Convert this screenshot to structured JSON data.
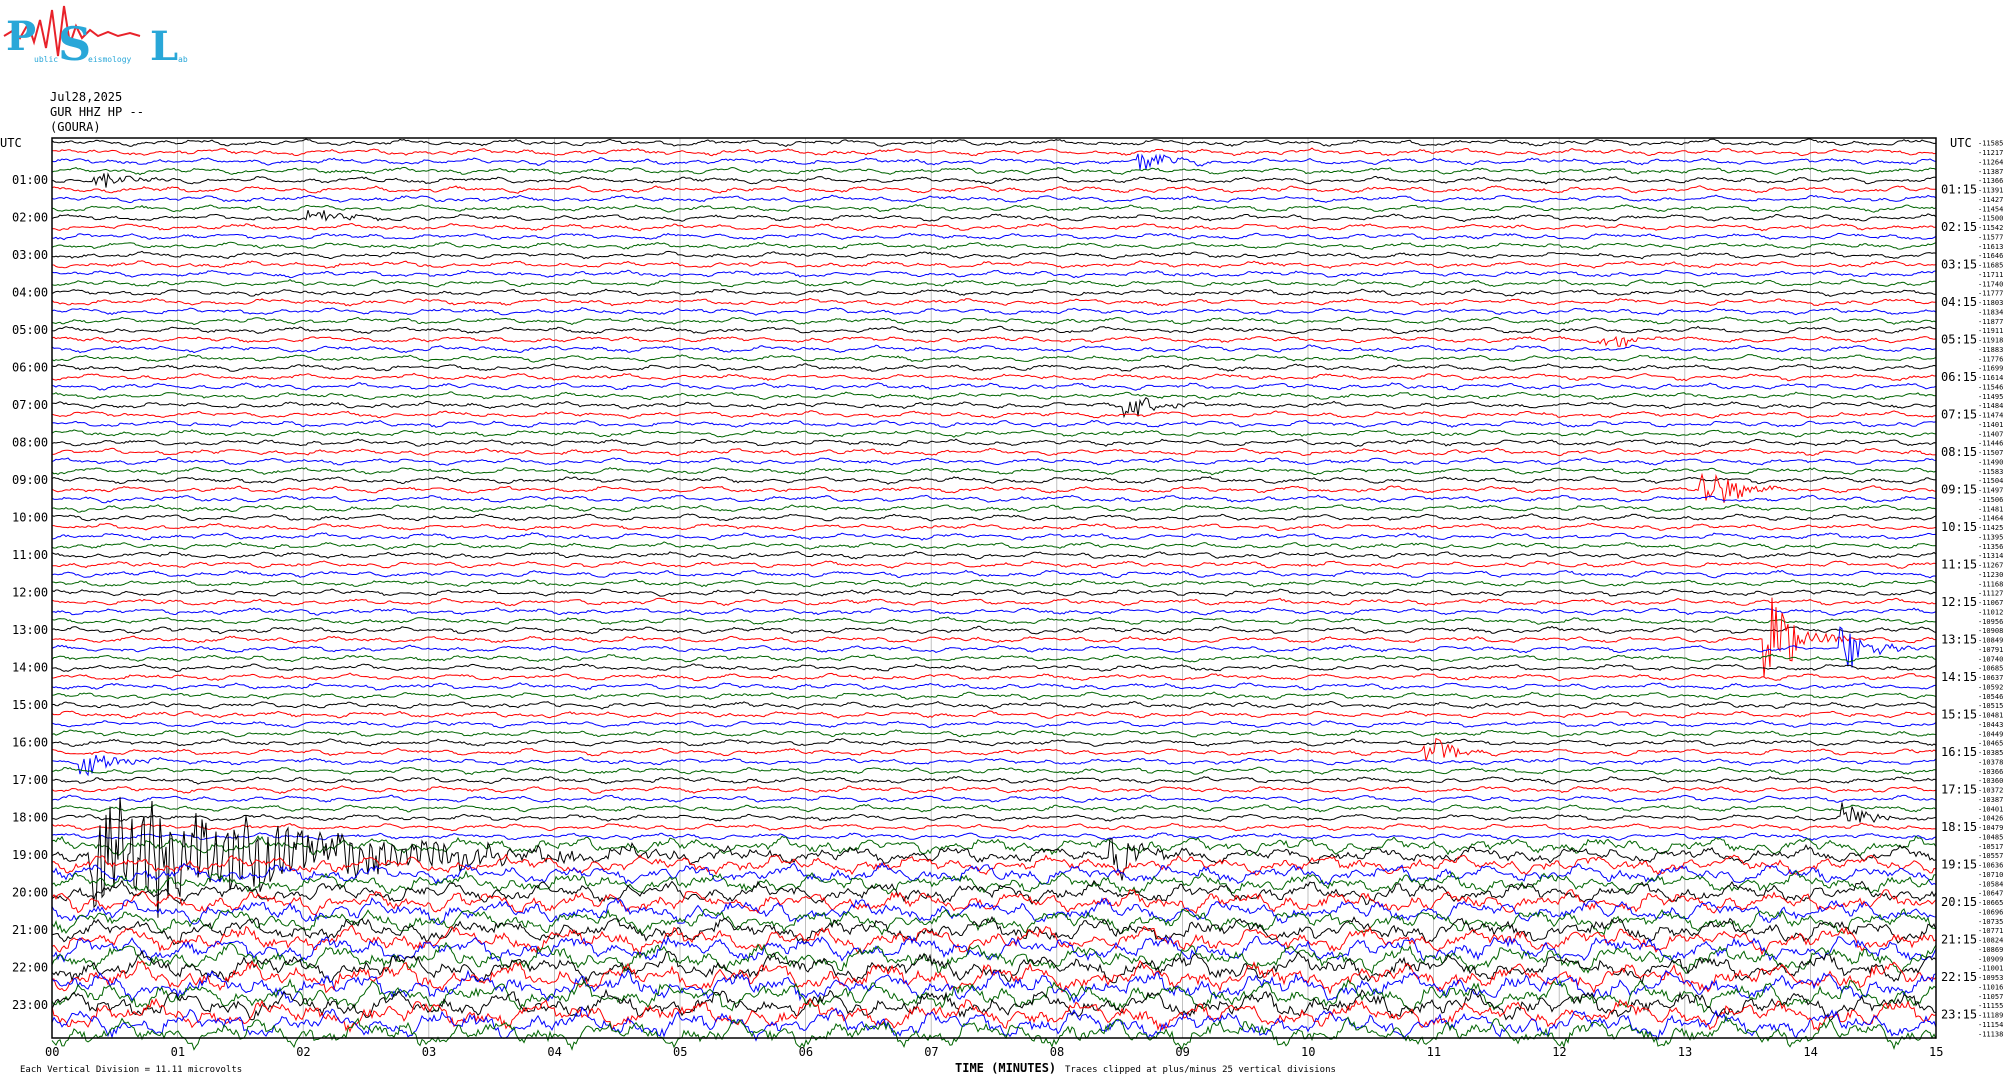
{
  "logo": {
    "letters": [
      "P",
      "S",
      "L"
    ],
    "subtext": [
      "ublic",
      "eismology",
      "ab"
    ],
    "colors": {
      "letters": "#29a7d8",
      "squiggle": "#e8222a"
    }
  },
  "header": {
    "date": "Jul28,2025",
    "station": "GUR HHZ HP --",
    "location": "(GOURA)"
  },
  "axis": {
    "left_label": "UTC",
    "right_label": "UTC",
    "left_hours": [
      "01:00",
      "02:00",
      "03:00",
      "04:00",
      "05:00",
      "06:00",
      "07:00",
      "08:00",
      "09:00",
      "10:00",
      "11:00",
      "12:00",
      "13:00",
      "14:00",
      "15:00",
      "16:00",
      "17:00",
      "18:00",
      "19:00",
      "20:00",
      "21:00",
      "22:00",
      "23:00"
    ],
    "right_hours": [
      "01:15",
      "02:15",
      "03:15",
      "04:15",
      "05:15",
      "06:15",
      "07:15",
      "08:15",
      "09:15",
      "10:15",
      "11:15",
      "12:15",
      "13:15",
      "14:15",
      "15:15",
      "16:15",
      "17:15",
      "18:15",
      "19:15",
      "20:15",
      "21:15",
      "22:15",
      "23:15"
    ],
    "x_ticks": [
      "00",
      "01",
      "02",
      "03",
      "04",
      "05",
      "06",
      "07",
      "08",
      "09",
      "10",
      "11",
      "12",
      "13",
      "14",
      "15"
    ],
    "x_title": "TIME (MINUTES)"
  },
  "footer": {
    "left": "Each Vertical Division = 11.11 microvolts",
    "clip_note": "Traces clipped at plus/minus 25 vertical divisions"
  },
  "chart_data": {
    "type": "line",
    "title": "Jul28,2025 GUR HHZ HP -- (GOURA)",
    "xlabel": "TIME (MINUTES)",
    "ylabel": "UTC",
    "xlim": [
      0,
      15
    ],
    "x": [
      "00",
      "01",
      "02",
      "03",
      "04",
      "05",
      "06",
      "07",
      "08",
      "09",
      "10",
      "11",
      "12",
      "13",
      "14",
      "15"
    ],
    "grid": true,
    "trace_count": 96,
    "trace_colors": [
      "#000000",
      "#ff0000",
      "#0000ff",
      "#006400"
    ],
    "right_offsets": [
      "11585",
      "11217",
      "11264",
      "11387",
      "11366",
      "11391",
      "11427",
      "11454",
      "11500",
      "11542",
      "11577",
      "11613",
      "11646",
      "11685",
      "11711",
      "11740",
      "11777",
      "11803",
      "11834",
      "11877",
      "11911",
      "11918",
      "11883",
      "11776",
      "11699",
      "11614",
      "11546",
      "11495",
      "11484",
      "11474",
      "11401",
      "11407",
      "11446",
      "11507",
      "11490",
      "11583",
      "11504",
      "11497",
      "11506",
      "11481",
      "11464",
      "11425",
      "11395",
      "11356",
      "11314",
      "11267",
      "11230",
      "11168",
      "11127",
      "11067",
      "11012",
      "10956",
      "10908",
      "10849",
      "10791",
      "10740",
      "10685",
      "10637",
      "10592",
      "10546",
      "10515",
      "10481",
      "10443",
      "10449",
      "10465",
      "10385",
      "10378",
      "10366",
      "10360",
      "10372",
      "10387",
      "10401",
      "10426",
      "10479",
      "10485",
      "10517",
      "10557",
      "10636",
      "10710",
      "10584",
      "10647",
      "10665",
      "10696",
      "10735",
      "10771",
      "10824",
      "10869",
      "10909",
      "11001",
      "10953",
      "11016",
      "11057",
      "11155",
      "11189",
      "11154",
      "11138"
    ],
    "events": [
      {
        "time": "00:30",
        "minute": 8.7,
        "color": "#006400",
        "amplitude": "moderate"
      },
      {
        "time": "01:00",
        "minute": 0.4,
        "color": "#ff0000",
        "amplitude": "small"
      },
      {
        "time": "02:00",
        "minute": 2.1,
        "color": "#ff0000",
        "amplitude": "small"
      },
      {
        "time": "05:15",
        "minute": 12.4,
        "color": "#ff0000",
        "amplitude": "small"
      },
      {
        "time": "07:00",
        "minute": 8.6,
        "color": "#000000",
        "amplitude": "moderate"
      },
      {
        "time": "09:15",
        "minute": 13.2,
        "color": "#ff0000",
        "amplitude": "large"
      },
      {
        "time": "13:15",
        "minute": 13.7,
        "color": "#0000ff",
        "amplitude": "very large"
      },
      {
        "time": "13:30",
        "minute": 14.3,
        "color": "#0000ff",
        "amplitude": "large"
      },
      {
        "time": "16:15",
        "minute": 11.0,
        "color": "#ff0000",
        "amplitude": "moderate"
      },
      {
        "time": "16:30",
        "minute": 0.3,
        "color": "#0000ff",
        "amplitude": "moderate"
      },
      {
        "time": "18:00",
        "minute": 14.3,
        "color": "#000000",
        "amplitude": "moderate"
      },
      {
        "time": "19:00",
        "minute": 8.5,
        "color": "#006400",
        "amplitude": "large"
      },
      {
        "time": "19:00",
        "minute": 0.3,
        "color": "#0000ff",
        "amplitude": "clipped"
      }
    ]
  }
}
